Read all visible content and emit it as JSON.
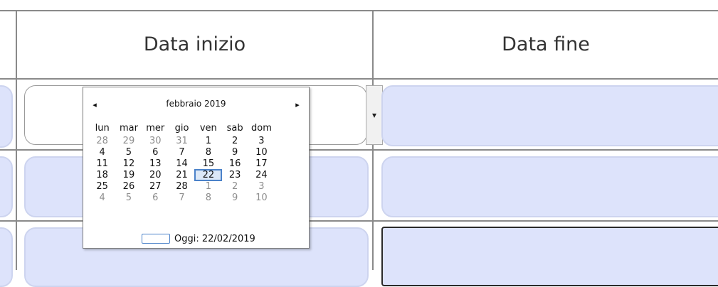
{
  "table": {
    "headers": [
      "Data inizio",
      "Data fine"
    ]
  },
  "dropdown": {
    "icon": "triangle-down-icon",
    "glyph": "▾"
  },
  "calendar": {
    "prev_glyph": "◂",
    "next_glyph": "▸",
    "month_label": "febbraio 2019",
    "weekdays": [
      "lun",
      "mar",
      "mer",
      "gio",
      "ven",
      "sab",
      "dom"
    ],
    "weeks": [
      [
        "28",
        "29",
        "30",
        "31",
        "1",
        "2",
        "3"
      ],
      [
        "4",
        "5",
        "6",
        "7",
        "8",
        "9",
        "10"
      ],
      [
        "11",
        "12",
        "13",
        "14",
        "15",
        "16",
        "17"
      ],
      [
        "18",
        "19",
        "20",
        "21",
        "22",
        "23",
        "24"
      ],
      [
        "25",
        "26",
        "27",
        "28",
        "1",
        "2",
        "3"
      ],
      [
        "4",
        "5",
        "6",
        "7",
        "8",
        "9",
        "10"
      ]
    ],
    "selected_day": "22",
    "today_label": "Oggi: 22/02/2019"
  },
  "colors": {
    "field_fill": "#dde3fb",
    "selection_border": "#4b82c9",
    "grid_line": "#8a8a8a"
  }
}
